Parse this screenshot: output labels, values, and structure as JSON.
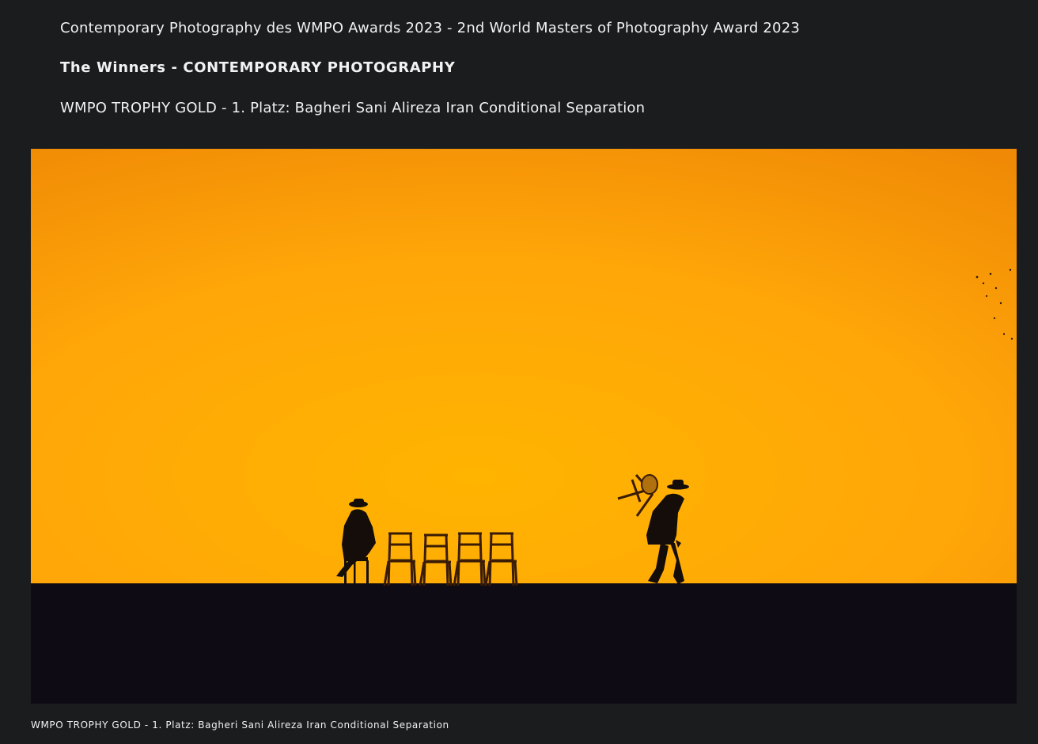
{
  "article": {
    "heading": "Contemporary Photography des WMPO Awards 2023 - 2nd World Masters of Photography Award 2023",
    "winners_title": "The Winners - CONTEMPORARY PHOTOGRAPHY",
    "trophy_line": "WMPO TROPHY GOLD - 1. Platz: Bagheri Sani Alireza Iran Conditional Separation"
  },
  "photo": {
    "caption": "WMPO TROPHY GOLD - 1. Platz: Bagheri Sani Alireza Iran Conditional Separation",
    "sky_color": "#ffae00",
    "ground_color": "#0e0b14"
  }
}
